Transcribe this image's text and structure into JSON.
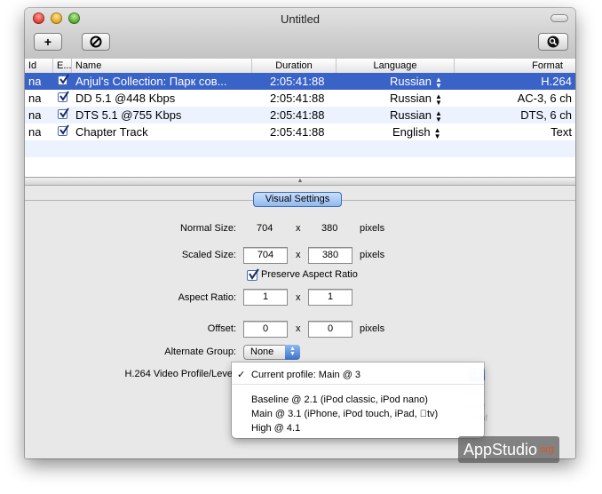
{
  "window": {
    "title": "Untitled"
  },
  "toolbar": {
    "add_label": "+",
    "stop_icon": "prohibit-icon",
    "search_icon": "magnifier-icon"
  },
  "table": {
    "headers": [
      "Id",
      "E...",
      "Name",
      "Duration",
      "Language",
      "Format"
    ],
    "rows": [
      {
        "id": "na",
        "enabled": true,
        "name": "Anjul's Collection: Парк сов...",
        "duration": "2:05:41:88",
        "language": "Russian",
        "format": "H.264"
      },
      {
        "id": "na",
        "enabled": true,
        "name": "DD 5.1 @448 Kbps",
        "duration": "2:05:41:88",
        "language": "Russian",
        "format": "AC-3, 6 ch"
      },
      {
        "id": "na",
        "enabled": true,
        "name": "DTS 5.1 @755 Kbps",
        "duration": "2:05:41:88",
        "language": "Russian",
        "format": "DTS, 6 ch"
      },
      {
        "id": "na",
        "enabled": true,
        "name": "Chapter Track",
        "duration": "2:05:41:88",
        "language": "English",
        "format": "Text"
      }
    ]
  },
  "panel": {
    "tab_label": "Visual Settings",
    "normal_size_label": "Normal Size:",
    "normal_width": "704",
    "normal_x": "x",
    "normal_height": "380",
    "normal_unit": "pixels",
    "scaled_size_label": "Scaled Size:",
    "scaled_width": "704",
    "scaled_x": "x",
    "scaled_height": "380",
    "scaled_unit": "pixels",
    "preserve_label": "Preserve Aspect Ratio",
    "preserve_checked": true,
    "aspect_label": "Aspect Ratio:",
    "aspect_w": "1",
    "aspect_x": "x",
    "aspect_h": "1",
    "offset_label": "Offset:",
    "offset_x_val": "0",
    "offset_x": "x",
    "offset_y_val": "0",
    "offset_unit": "pixels",
    "alt_group_label": "Alternate Group:",
    "alt_group_value": "None",
    "profile_label": "H.264 Video Profile/Leve"
  },
  "profile_menu": {
    "current": "Current profile: Main @ 3",
    "check": "✓",
    "options": [
      "Baseline @ 2.1 (iPod classic, iPod nano)",
      "Main @ 3.1 (iPhone, iPod touch, iPad, tv)",
      "High @ 4.1"
    ]
  },
  "watermark": {
    "main": "AppStudio",
    "suffix": ".org"
  }
}
